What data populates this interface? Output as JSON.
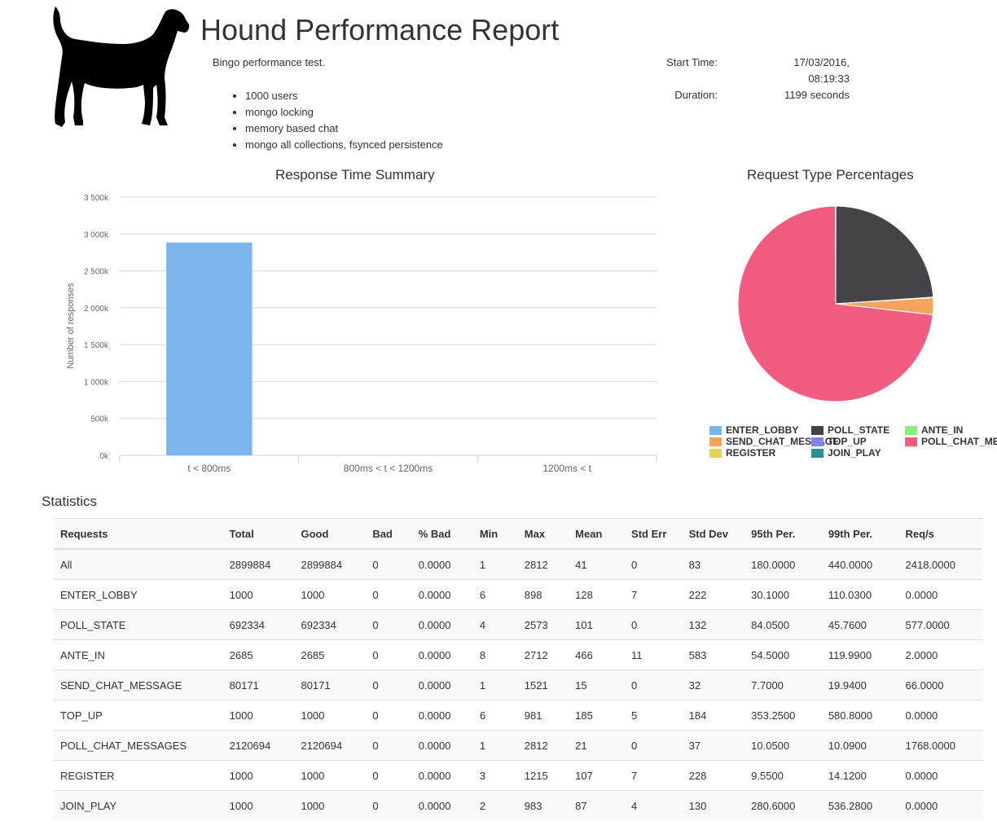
{
  "header": {
    "title": "Hound Performance Report",
    "description": "Bingo performance test.",
    "bullets": [
      "1000 users",
      "mongo locking",
      "memory based chat",
      "mongo all collections, fsynced persistence"
    ],
    "start_time_label": "Start Time:",
    "start_time_line1": "17/03/2016,",
    "start_time_line2": "08:19:33",
    "duration_label": "Duration:",
    "duration_value": "1199 seconds",
    "logo_icon": "hound-dog-silhouette-icon"
  },
  "bar_chart_labels": {
    "title": "Response Time Summary",
    "ylabel": "Number of responses"
  },
  "pie_chart_labels": {
    "title": "Request Type Percentages"
  },
  "chart_data": [
    {
      "type": "bar",
      "title": "Response Time Summary",
      "xlabel": "",
      "ylabel": "Number of responses",
      "categories": [
        "t < 800ms",
        "800ms < t < 1200ms",
        "1200ms < t"
      ],
      "values": [
        2885000,
        0,
        0
      ],
      "ylim": [
        0,
        3500000
      ],
      "yticks": [
        "0k",
        "500k",
        "1 000k",
        "1 500k",
        "2 000k",
        "2 500k",
        "3 000k",
        "3 500k"
      ],
      "color": "#7cb5ec",
      "grid": true
    },
    {
      "type": "pie",
      "title": "Request Type Percentages",
      "legend_position": "bottom",
      "slices": [
        {
          "name": "ENTER_LOBBY",
          "value": 1000,
          "color": "#7cb5ec"
        },
        {
          "name": "POLL_STATE",
          "value": 692334,
          "color": "#434348"
        },
        {
          "name": "ANTE_IN",
          "value": 2685,
          "color": "#90ed7d"
        },
        {
          "name": "SEND_CHAT_MESSAGE",
          "value": 80171,
          "color": "#f7a35c"
        },
        {
          "name": "TOP_UP",
          "value": 1000,
          "color": "#8085e9"
        },
        {
          "name": "POLL_CHAT_MESSAGES",
          "value": 2120694,
          "color": "#f15c80"
        },
        {
          "name": "REGISTER",
          "value": 1000,
          "color": "#e4d354"
        },
        {
          "name": "JOIN_PLAY",
          "value": 1000,
          "color": "#2b908f"
        }
      ]
    }
  ],
  "statistics": {
    "title": "Statistics",
    "columns": [
      "Requests",
      "Total",
      "Good",
      "Bad",
      "% Bad",
      "Min",
      "Max",
      "Mean",
      "Std Err",
      "Std Dev",
      "95th Per.",
      "99th Per.",
      "Req/s"
    ],
    "rows": [
      [
        "All",
        "2899884",
        "2899884",
        "0",
        "0.0000",
        "1",
        "2812",
        "41",
        "0",
        "83",
        "180.0000",
        "440.0000",
        "2418.0000"
      ],
      [
        "ENTER_LOBBY",
        "1000",
        "1000",
        "0",
        "0.0000",
        "6",
        "898",
        "128",
        "7",
        "222",
        "30.1000",
        "110.0300",
        "0.0000"
      ],
      [
        "POLL_STATE",
        "692334",
        "692334",
        "0",
        "0.0000",
        "4",
        "2573",
        "101",
        "0",
        "132",
        "84.0500",
        "45.7600",
        "577.0000"
      ],
      [
        "ANTE_IN",
        "2685",
        "2685",
        "0",
        "0.0000",
        "8",
        "2712",
        "466",
        "11",
        "583",
        "54.5000",
        "119.9900",
        "2.0000"
      ],
      [
        "SEND_CHAT_MESSAGE",
        "80171",
        "80171",
        "0",
        "0.0000",
        "1",
        "1521",
        "15",
        "0",
        "32",
        "7.7000",
        "19.9400",
        "66.0000"
      ],
      [
        "TOP_UP",
        "1000",
        "1000",
        "0",
        "0.0000",
        "6",
        "981",
        "185",
        "5",
        "184",
        "353.2500",
        "580.8000",
        "0.0000"
      ],
      [
        "POLL_CHAT_MESSAGES",
        "2120694",
        "2120694",
        "0",
        "0.0000",
        "1",
        "2812",
        "21",
        "0",
        "37",
        "10.0500",
        "10.0900",
        "1768.0000"
      ],
      [
        "REGISTER",
        "1000",
        "1000",
        "0",
        "0.0000",
        "3",
        "1215",
        "107",
        "7",
        "228",
        "9.5500",
        "14.1200",
        "0.0000"
      ],
      [
        "JOIN_PLAY",
        "1000",
        "1000",
        "0",
        "0.0000",
        "2",
        "983",
        "87",
        "4",
        "130",
        "280.6000",
        "536.2800",
        "0.0000"
      ]
    ]
  }
}
